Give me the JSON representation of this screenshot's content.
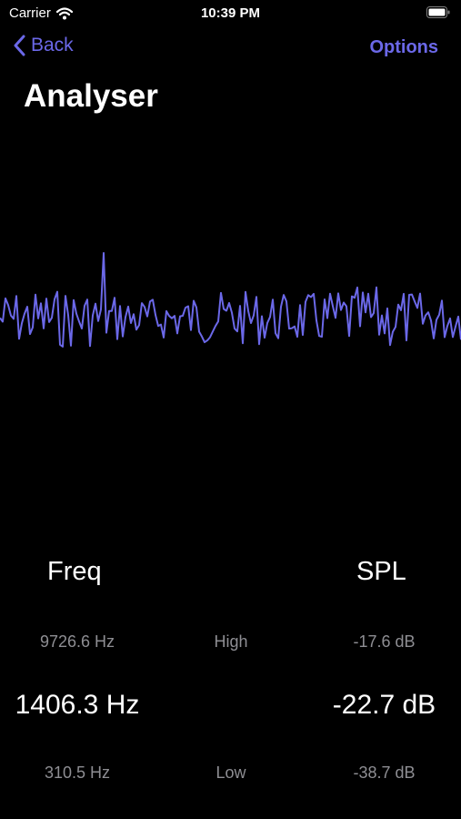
{
  "status_bar": {
    "carrier": "Carrier",
    "time": "10:39 PM",
    "icons": [
      "wifi-icon",
      "battery-icon"
    ]
  },
  "nav": {
    "back_label": "Back",
    "options_label": "Options",
    "accent_color": "#6b68e8"
  },
  "page": {
    "title": "Analyser"
  },
  "waveform": {
    "color": "#6b68e8"
  },
  "stats": {
    "freq_header": "Freq",
    "spl_header": "SPL",
    "high_freq": "9726.6 Hz",
    "high_label": "High",
    "high_spl": "-17.6 dB",
    "current_freq": "1406.3 Hz",
    "current_spl": "-22.7 dB",
    "low_freq": "310.5 Hz",
    "low_label": "Low",
    "low_spl": "-38.7 dB"
  }
}
